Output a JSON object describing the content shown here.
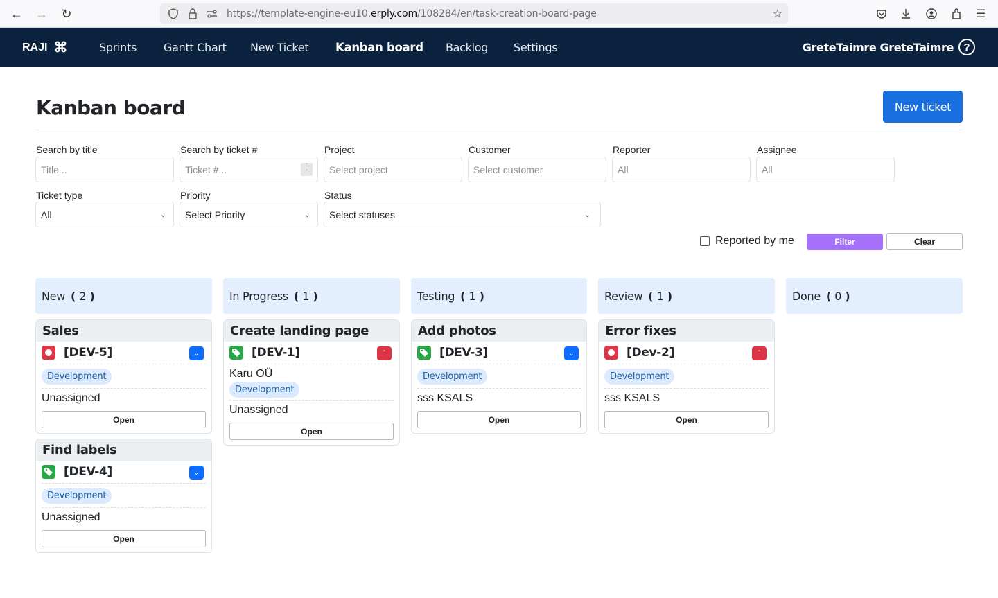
{
  "browser": {
    "url_prefix": "https://template-engine-eu10.",
    "url_domain": "erply.com",
    "url_path": "/108284/en/task-creation-board-page"
  },
  "nav": {
    "brand": "RAJI",
    "brand_icon": "command-icon",
    "links": [
      "Sprints",
      "Gantt Chart",
      "New Ticket",
      "Kanban board",
      "Backlog",
      "Settings"
    ],
    "active": "Kanban board",
    "user": "GreteTaimre GreteTaimre",
    "help": "?"
  },
  "page": {
    "title": "Kanban board",
    "new_ticket_label": "New ticket"
  },
  "filters": {
    "title": {
      "label": "Search by title",
      "placeholder": "Title..."
    },
    "ticket": {
      "label": "Search by ticket #",
      "placeholder": "Ticket #..."
    },
    "project": {
      "label": "Project",
      "placeholder": "Select project"
    },
    "customer": {
      "label": "Customer",
      "placeholder": "Select customer"
    },
    "reporter": {
      "label": "Reporter",
      "placeholder": "All"
    },
    "assignee": {
      "label": "Assignee",
      "placeholder": "All"
    },
    "ticket_type": {
      "label": "Ticket type",
      "value": "All"
    },
    "priority": {
      "label": "Priority",
      "value": "Select Priority"
    },
    "status": {
      "label": "Status",
      "value": "Select statuses"
    },
    "reported_by_me": {
      "label": "Reported by me",
      "checked": false
    },
    "filter_label": "Filter",
    "clear_label": "Clear"
  },
  "colors": {
    "nav_bg": "#0c2340",
    "primary": "#1a6fe0",
    "filter_btn": "#a370f7",
    "column_header_bg": "#e3efff",
    "bug": "#dc3545",
    "feature": "#28a745",
    "priority_low": "#0d6efd",
    "priority_high": "#dc3545"
  },
  "columns": [
    {
      "name": "New",
      "count": "2",
      "cards": [
        {
          "title": "Sales",
          "key": "[DEV-5]",
          "type": "bug",
          "priority": "low",
          "customer": "",
          "tag": "Development",
          "assignee": "Unassigned",
          "open_label": "Open"
        },
        {
          "title": "Find labels",
          "key": "[DEV-4]",
          "type": "feature",
          "priority": "low",
          "customer": "",
          "tag": "Development",
          "assignee": "Unassigned",
          "open_label": "Open"
        }
      ]
    },
    {
      "name": "In Progress",
      "count": "1",
      "cards": [
        {
          "title": "Create landing page",
          "key": "[DEV-1]",
          "type": "feature",
          "priority": "high",
          "customer": "Karu OÜ",
          "tag": "Development",
          "assignee": "Unassigned",
          "open_label": "Open"
        }
      ]
    },
    {
      "name": "Testing",
      "count": "1",
      "cards": [
        {
          "title": "Add photos",
          "key": "[DEV-3]",
          "type": "feature",
          "priority": "low",
          "customer": "",
          "tag": "Development",
          "assignee": "sss KSALS",
          "open_label": "Open"
        }
      ]
    },
    {
      "name": "Review",
      "count": "1",
      "cards": [
        {
          "title": "Error fixes",
          "key": "[Dev-2]",
          "type": "bug",
          "priority": "high",
          "customer": "",
          "tag": "Development",
          "assignee": "sss KSALS",
          "open_label": "Open"
        }
      ]
    },
    {
      "name": "Done",
      "count": "0",
      "cards": []
    }
  ]
}
